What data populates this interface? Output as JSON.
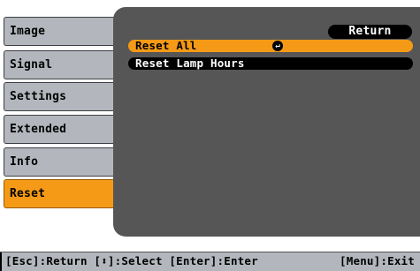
{
  "menu": {
    "items": [
      {
        "label": "Image"
      },
      {
        "label": "Signal"
      },
      {
        "label": "Settings"
      },
      {
        "label": "Extended"
      },
      {
        "label": "Info"
      },
      {
        "label": "Reset",
        "active": true
      }
    ]
  },
  "panel": {
    "return_label": "Return",
    "options": [
      {
        "label": "Reset All",
        "selected": true,
        "icon": "enter-icon"
      },
      {
        "label": "Reset Lamp Hours",
        "selected": false
      }
    ]
  },
  "footer": {
    "left": "[Esc]:Return [⬍]:Select [Enter]:Enter",
    "right": "[Menu]:Exit"
  },
  "colors": {
    "accent": "#f59a16",
    "panel": "#565656",
    "sidebar_item": "#b3b7bd"
  }
}
